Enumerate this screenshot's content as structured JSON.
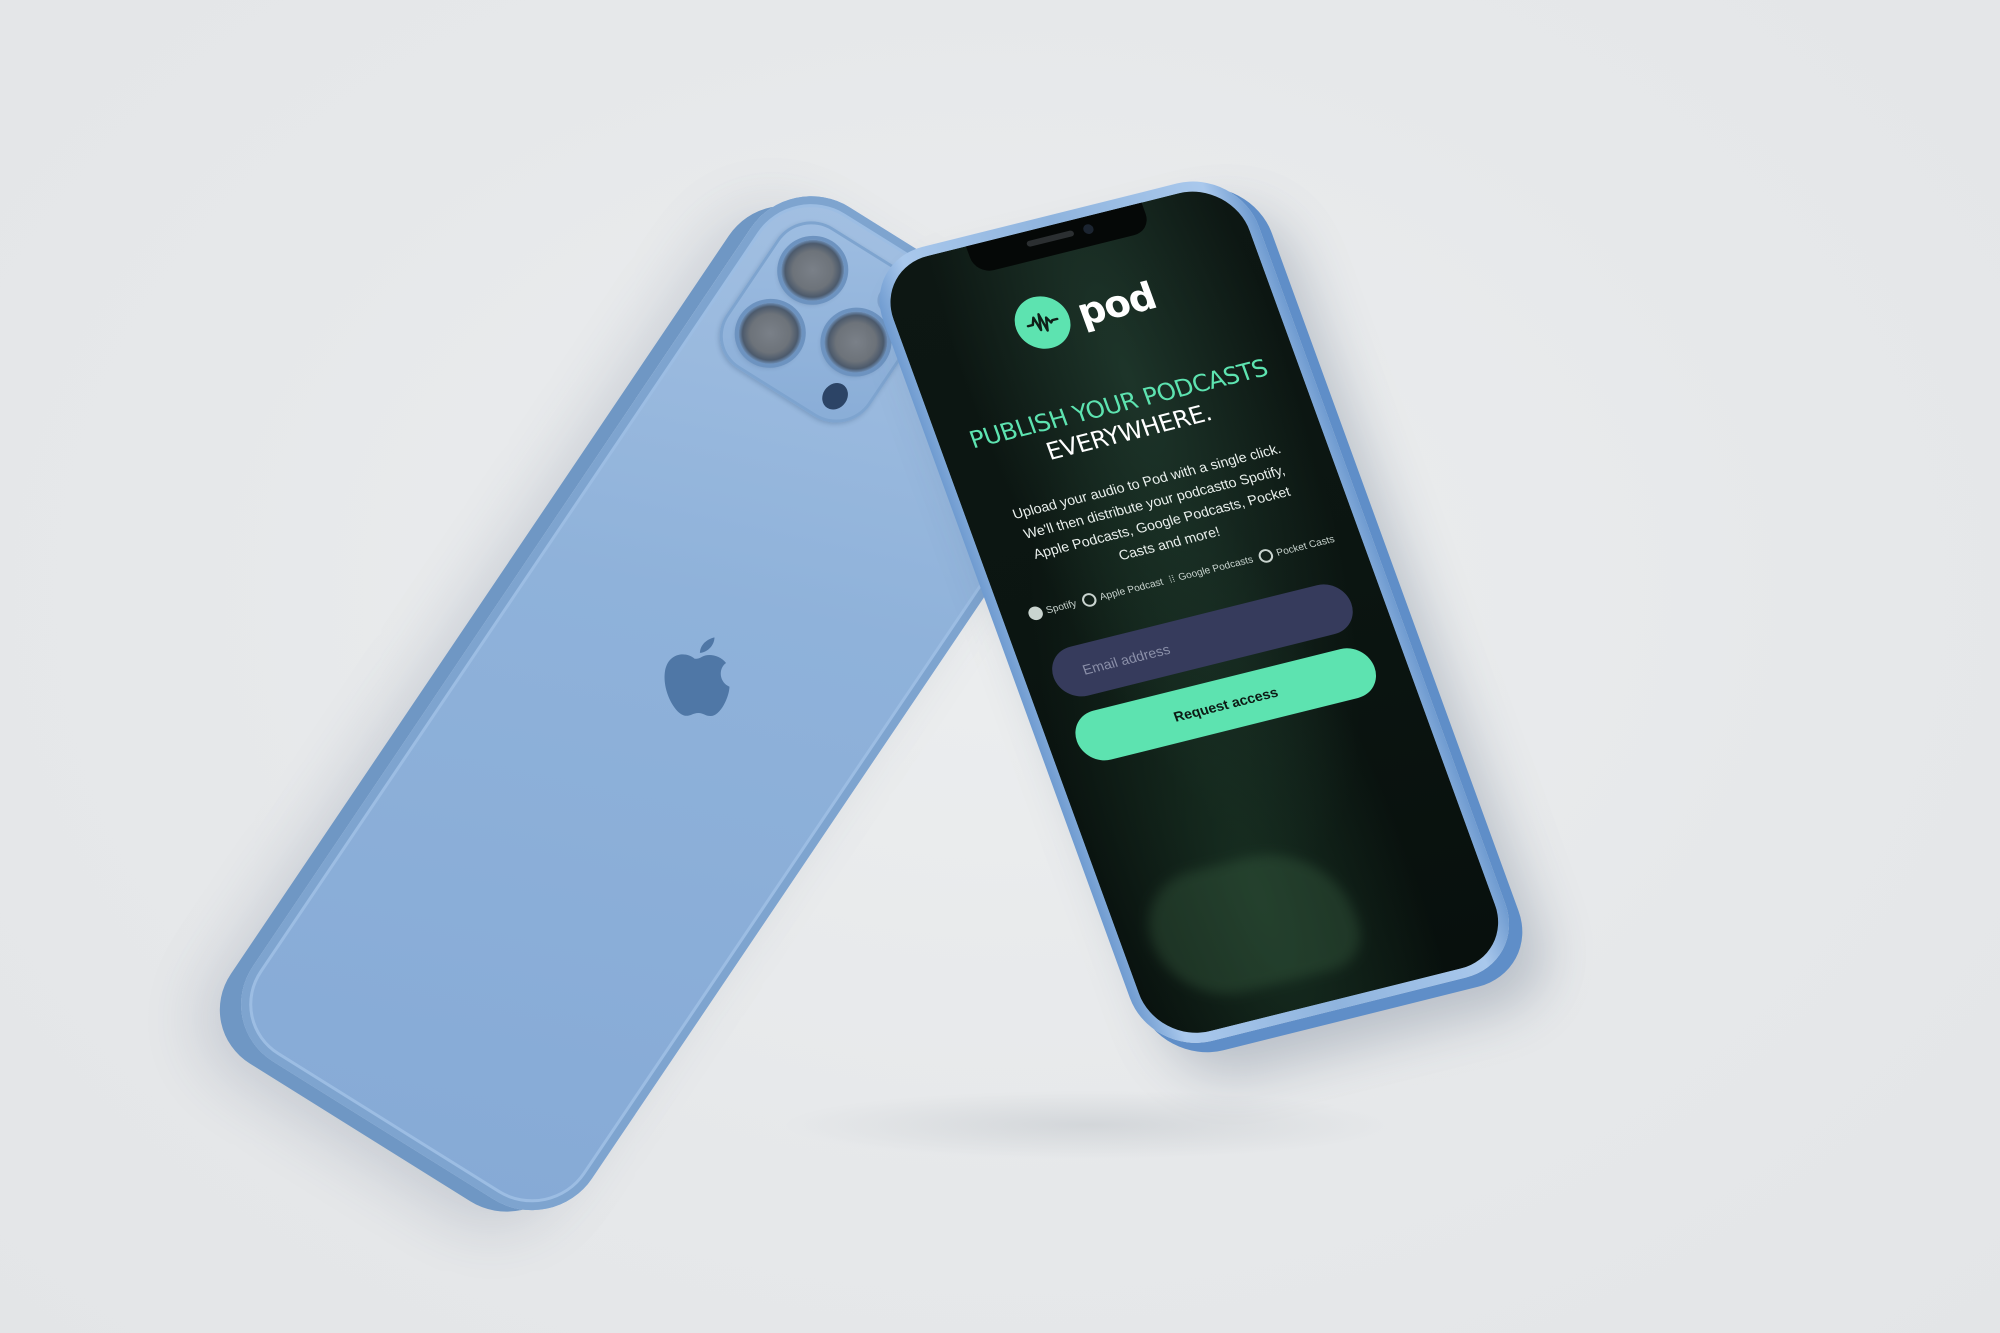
{
  "brand": {
    "name": "pod",
    "accent_color": "#5de3b0",
    "logo_icon": "waveform-icon"
  },
  "hero": {
    "headline_accent": "PUBLISH YOUR PODCASTS",
    "headline_plain": "EVERYWHERE.",
    "subtext": "Upload your audio to Pod with a single click. We'll then distribute your podcastto Spotify, Apple Podcasts, Google Podcasts, Pocket Casts and more!"
  },
  "platforms": [
    {
      "label": "Spotify",
      "icon": "spotify-icon"
    },
    {
      "label": "Apple Podcast",
      "icon": "apple-podcast-icon"
    },
    {
      "label": "Google Podcasts",
      "icon": "google-podcasts-icon"
    },
    {
      "label": "Pocket Casts",
      "icon": "pocket-casts-icon"
    }
  ],
  "form": {
    "email_placeholder": "Email address",
    "email_value": "",
    "submit_label": "Request access"
  },
  "device": {
    "finish_color": "#8fb2da",
    "screen_background": "#0b1511"
  }
}
